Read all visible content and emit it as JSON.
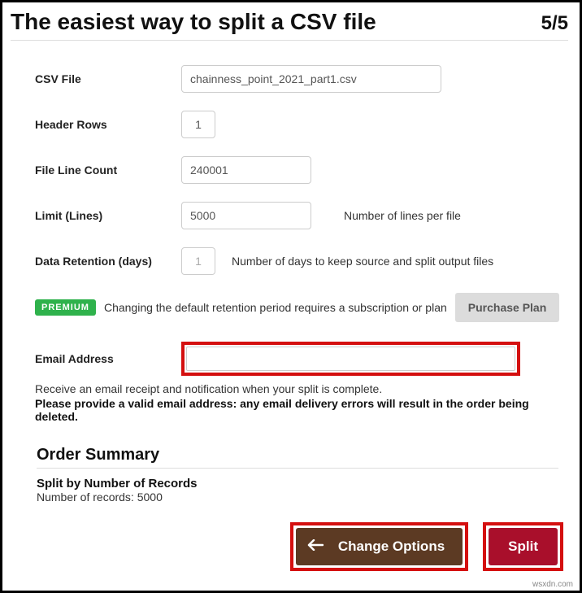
{
  "header": {
    "title": "The easiest way to split a CSV file",
    "step": "5/5"
  },
  "form": {
    "csv_file": {
      "label": "CSV File",
      "value": "chainness_point_2021_part1.csv"
    },
    "header_rows": {
      "label": "Header Rows",
      "value": "1"
    },
    "line_count": {
      "label": "File Line Count",
      "value": "240001"
    },
    "limit": {
      "label": "Limit (Lines)",
      "value": "5000",
      "hint": "Number of lines per file"
    },
    "retention": {
      "label": "Data Retention (days)",
      "value": "1",
      "hint": "Number of days to keep source and split output files"
    },
    "premium": {
      "badge": "PREMIUM",
      "text": "Changing the default retention period requires a subscription or plan",
      "button": "Purchase Plan"
    },
    "email": {
      "label": "Email Address",
      "value": ""
    },
    "notes": {
      "line1": "Receive an email receipt and notification when your split is complete.",
      "line2": "Please provide a valid email address: any email delivery errors will result in the order being deleted."
    }
  },
  "summary": {
    "title": "Order Summary",
    "method": "Split by Number of Records",
    "records": "Number of records: 5000"
  },
  "footer": {
    "change": "Change Options",
    "split": "Split"
  },
  "watermark": "wsxdn.com"
}
